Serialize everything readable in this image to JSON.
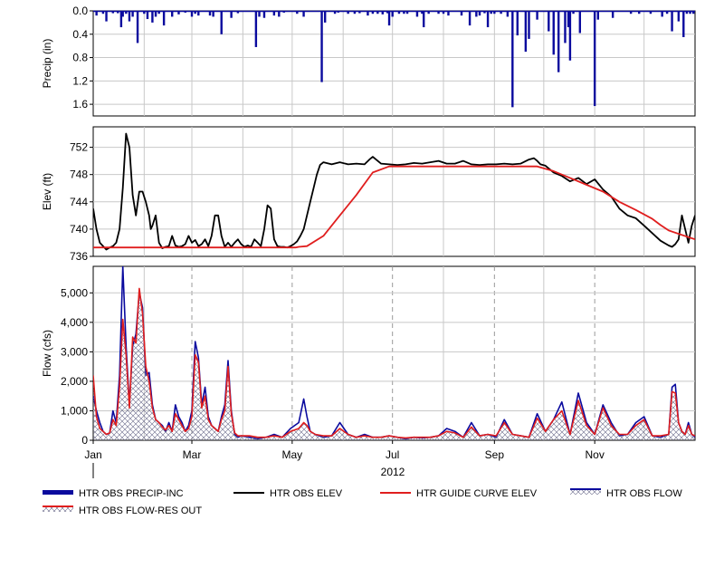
{
  "chart_data": [
    {
      "type": "bar",
      "ylabel": "Precip (in)",
      "ylim": [
        0,
        1.8
      ],
      "y_inverted": true,
      "yticks": [
        "0.0",
        "0.4",
        "0.8",
        "1.2",
        "1.6"
      ],
      "grid": true,
      "series": [
        {
          "name": "HTR OBS PRECIP-INC",
          "color": "#0a0a9e",
          "x_day": [
            2,
            6,
            8,
            12,
            15,
            17,
            18,
            20,
            22,
            24,
            27,
            31,
            33,
            36,
            38,
            40,
            43,
            48,
            52,
            56,
            60,
            62,
            64,
            71,
            73,
            78,
            84,
            88,
            99,
            101,
            104,
            110,
            113,
            116,
            124,
            128,
            139,
            141,
            147,
            149,
            155,
            159,
            162,
            167,
            170,
            173,
            176,
            179,
            180,
            182,
            186,
            189,
            191,
            197,
            200,
            201,
            204,
            210,
            213,
            216,
            224,
            229,
            233,
            235,
            238,
            240,
            242,
            244,
            248,
            252,
            255,
            258,
            263,
            265,
            270,
            277,
            280,
            283,
            287,
            289,
            290,
            292,
            296,
            305,
            307,
            316,
            327,
            332,
            339,
            346,
            349,
            352,
            356,
            359,
            361,
            363,
            365
          ],
          "values": [
            0.08,
            0.05,
            0.18,
            0.04,
            0.04,
            0.28,
            0.1,
            0.05,
            0.18,
            0.1,
            0.55,
            0.05,
            0.14,
            0.2,
            0.1,
            0.05,
            0.25,
            0.1,
            0.06,
            0.03,
            0.1,
            0.05,
            0.08,
            0.08,
            0.1,
            0.4,
            0.12,
            0.04,
            0.62,
            0.1,
            0.12,
            0.08,
            0.1,
            0.03,
            0.05,
            0.1,
            1.22,
            0.2,
            0.05,
            0.03,
            0.05,
            0.05,
            0.04,
            0.08,
            0.05,
            0.05,
            0.06,
            0.04,
            0.25,
            0.1,
            0.05,
            0.05,
            0.05,
            0.1,
            0.05,
            0.28,
            0.05,
            0.05,
            0.05,
            0.08,
            0.08,
            0.25,
            0.1,
            0.08,
            0.04,
            0.28,
            0.05,
            0.05,
            0.05,
            0.1,
            1.65,
            0.42,
            0.7,
            0.48,
            0.15,
            0.35,
            0.75,
            1.05,
            0.55,
            0.28,
            0.85,
            0.05,
            0.38,
            1.63,
            0.15,
            0.12,
            0.05,
            0.05,
            0.05,
            0.1,
            0.05,
            0.35,
            0.18,
            0.45,
            0.05,
            0.05,
            0.05
          ]
        }
      ]
    },
    {
      "type": "line",
      "ylabel": "Elev (ft)",
      "ylim": [
        736,
        755
      ],
      "yticks": [
        "736",
        "740",
        "744",
        "748",
        "752"
      ],
      "grid": true,
      "series": [
        {
          "name": "HTR OBS ELEV",
          "color": "#000000",
          "x_day": [
            0,
            2,
            4,
            6,
            8,
            10,
            12,
            14,
            16,
            18,
            20,
            22,
            24,
            26,
            28,
            30,
            32,
            34,
            35,
            36,
            38,
            40,
            42,
            44,
            46,
            48,
            50,
            52,
            54,
            56,
            58,
            60,
            62,
            64,
            66,
            68,
            70,
            72,
            74,
            76,
            78,
            80,
            82,
            84,
            86,
            88,
            90,
            92,
            94,
            96,
            98,
            100,
            102,
            104,
            106,
            108,
            110,
            112,
            114,
            116,
            118,
            120,
            122,
            124,
            126,
            128,
            130,
            132,
            134,
            136,
            138,
            140,
            145,
            150,
            155,
            160,
            165,
            168,
            170,
            172,
            175,
            180,
            185,
            190,
            195,
            200,
            205,
            210,
            215,
            220,
            225,
            230,
            235,
            240,
            245,
            250,
            255,
            260,
            265,
            268,
            270,
            272,
            275,
            280,
            285,
            290,
            295,
            300,
            305,
            310,
            315,
            320,
            325,
            330,
            335,
            340,
            345,
            350,
            352,
            354,
            356,
            358,
            360,
            362,
            364,
            366
          ],
          "values": [
            743,
            740,
            738,
            737.5,
            737,
            737.3,
            737.5,
            738,
            740,
            746,
            754,
            752,
            745,
            742,
            745.5,
            745.5,
            744,
            742,
            740,
            740.5,
            742,
            738,
            737.2,
            737.4,
            737.5,
            739,
            737.6,
            737.4,
            737.5,
            737.8,
            739,
            738,
            738.4,
            737.5,
            737.8,
            738.5,
            737.5,
            739,
            742,
            742,
            739,
            737.4,
            738,
            737.4,
            738,
            738.5,
            737.8,
            737.4,
            737.6,
            737.4,
            738.5,
            738,
            737.5,
            740,
            743.5,
            743,
            738.5,
            737.5,
            737.4,
            737.4,
            737.3,
            737.5,
            737.8,
            738.2,
            739,
            740,
            742,
            744,
            746,
            748,
            749.4,
            749.8,
            749.5,
            749.8,
            749.5,
            749.6,
            749.5,
            750.2,
            750.6,
            750.2,
            749.6,
            749.5,
            749.4,
            749.5,
            749.7,
            749.6,
            749.8,
            750,
            749.6,
            749.6,
            750,
            749.5,
            749.4,
            749.5,
            749.5,
            749.6,
            749.5,
            749.6,
            750.2,
            750.4,
            750,
            749.5,
            749.3,
            748.3,
            747.8,
            747,
            747.5,
            746.6,
            747.3,
            745.8,
            744.8,
            743,
            742,
            741.6,
            740.5,
            739.4,
            738.3,
            737.6,
            737.4,
            737.8,
            738.5,
            742,
            740,
            738,
            740.5,
            742,
            738,
            737.5
          ]
        },
        {
          "name": "HTR GUIDE CURVE ELEV",
          "color": "#e01e1e",
          "x_day": [
            0,
            5,
            10,
            60,
            90,
            100,
            110,
            120,
            123,
            125,
            130,
            140,
            150,
            160,
            170,
            180,
            190,
            200,
            210,
            220,
            230,
            240,
            250,
            260,
            270,
            280,
            290,
            300,
            310,
            320,
            330,
            340,
            345,
            350,
            366
          ],
          "values": [
            737.3,
            737.3,
            737.3,
            737.3,
            737.3,
            737.3,
            737.3,
            737.3,
            737.3,
            737.4,
            737.5,
            739,
            742,
            745,
            748.3,
            749.2,
            749.2,
            749.2,
            749.2,
            749.2,
            749.2,
            749.2,
            749.2,
            749.2,
            749.2,
            748.5,
            747.5,
            746.5,
            745.5,
            744,
            742.8,
            741.5,
            740.6,
            739.8,
            738.5,
            737.3,
            737.3
          ]
        }
      ]
    },
    {
      "type": "line",
      "ylabel": "Flow (cfs)",
      "ylim": [
        0,
        5900
      ],
      "yticks": [
        "0",
        "1,000",
        "2,000",
        "3,000",
        "4,000",
        "5,000"
      ],
      "grid": true,
      "series": [
        {
          "name": "HTR OBS FLOW",
          "color": "#0a0a9e",
          "x_day": [
            0,
            2,
            4,
            6,
            8,
            10,
            12,
            14,
            16,
            18,
            20,
            22,
            24,
            26,
            28,
            30,
            32,
            34,
            36,
            38,
            40,
            42,
            44,
            46,
            48,
            50,
            52,
            54,
            56,
            58,
            60,
            62,
            64,
            66,
            68,
            70,
            72,
            74,
            76,
            78,
            80,
            82,
            84,
            86,
            88,
            90,
            95,
            100,
            105,
            110,
            115,
            120,
            125,
            128,
            130,
            132,
            135,
            140,
            145,
            150,
            155,
            160,
            165,
            170,
            175,
            180,
            185,
            190,
            195,
            200,
            205,
            210,
            215,
            220,
            225,
            230,
            235,
            240,
            245,
            250,
            255,
            260,
            265,
            270,
            275,
            280,
            285,
            290,
            295,
            300,
            305,
            310,
            315,
            320,
            325,
            330,
            335,
            340,
            345,
            350,
            352,
            354,
            356,
            358,
            360,
            362,
            364,
            366
          ],
          "values": [
            1500,
            1000,
            600,
            300,
            200,
            250,
            1000,
            600,
            2200,
            5900,
            3200,
            1200,
            3200,
            3600,
            5000,
            4500,
            2200,
            2300,
            1200,
            700,
            600,
            500,
            300,
            600,
            300,
            1200,
            800,
            600,
            300,
            500,
            1000,
            3350,
            2800,
            1200,
            1800,
            800,
            500,
            400,
            300,
            800,
            1200,
            2700,
            1000,
            200,
            100,
            150,
            100,
            50,
            100,
            200,
            100,
            400,
            600,
            1400,
            800,
            300,
            200,
            100,
            150,
            600,
            200,
            100,
            200,
            100,
            100,
            150,
            100,
            50,
            100,
            80,
            100,
            150,
            400,
            300,
            100,
            600,
            150,
            200,
            100,
            700,
            200,
            150,
            100,
            900,
            300,
            700,
            1300,
            200,
            1600,
            600,
            200,
            1200,
            600,
            150,
            200,
            600,
            800,
            150,
            100,
            200,
            1800,
            1900,
            600,
            300,
            200,
            600,
            200,
            100
          ]
        },
        {
          "name": "HTR OBS FLOW-RES OUT",
          "color": "#e01e1e",
          "x_day": [
            0,
            2,
            4,
            6,
            8,
            10,
            12,
            14,
            16,
            18,
            20,
            22,
            24,
            26,
            28,
            30,
            32,
            34,
            36,
            38,
            40,
            42,
            44,
            46,
            48,
            50,
            52,
            54,
            56,
            58,
            60,
            62,
            64,
            66,
            68,
            70,
            72,
            74,
            76,
            78,
            80,
            82,
            84,
            86,
            88,
            90,
            95,
            100,
            105,
            110,
            115,
            120,
            125,
            128,
            130,
            132,
            135,
            140,
            145,
            150,
            155,
            160,
            165,
            170,
            175,
            180,
            185,
            190,
            195,
            200,
            205,
            210,
            215,
            220,
            225,
            230,
            235,
            240,
            245,
            250,
            255,
            260,
            265,
            270,
            275,
            280,
            285,
            290,
            295,
            300,
            305,
            310,
            315,
            320,
            325,
            330,
            335,
            340,
            345,
            350,
            352,
            354,
            356,
            358,
            360,
            362,
            364,
            366
          ],
          "values": [
            2200,
            800,
            400,
            300,
            200,
            250,
            700,
            500,
            1800,
            4100,
            2900,
            1100,
            3500,
            3300,
            5150,
            4300,
            2500,
            2000,
            1100,
            700,
            600,
            450,
            350,
            500,
            300,
            900,
            700,
            500,
            300,
            400,
            800,
            2900,
            2650,
            1100,
            1500,
            700,
            500,
            400,
            300,
            700,
            1000,
            2500,
            900,
            250,
            150,
            150,
            150,
            100,
            100,
            150,
            100,
            300,
            400,
            600,
            500,
            300,
            200,
            150,
            150,
            400,
            200,
            100,
            150,
            100,
            100,
            150,
            100,
            80,
            100,
            100,
            100,
            150,
            300,
            250,
            100,
            450,
            150,
            200,
            150,
            600,
            200,
            150,
            100,
            750,
            300,
            700,
            1000,
            200,
            1350,
            500,
            200,
            1100,
            500,
            200,
            200,
            500,
            700,
            150,
            150,
            200,
            1650,
            1600,
            600,
            300,
            200,
            500,
            200,
            150
          ]
        }
      ]
    }
  ],
  "x_axis": {
    "ticks": [
      "Jan",
      "Mar",
      "May",
      "Jul",
      "Sep",
      "Nov"
    ],
    "year": "2012"
  },
  "legend": [
    {
      "label": "HTR OBS PRECIP-INC",
      "color": "#0a0a9e",
      "style": "bar"
    },
    {
      "label": "HTR OBS ELEV",
      "color": "#000000",
      "style": "line"
    },
    {
      "label": "HTR GUIDE CURVE ELEV",
      "color": "#e01e1e",
      "style": "line"
    },
    {
      "label": "HTR OBS FLOW",
      "color": "#0a0a9e",
      "style": "hatched"
    },
    {
      "label": "HTR OBS FLOW-RES OUT",
      "color": "#e01e1e",
      "style": "hatched"
    }
  ]
}
